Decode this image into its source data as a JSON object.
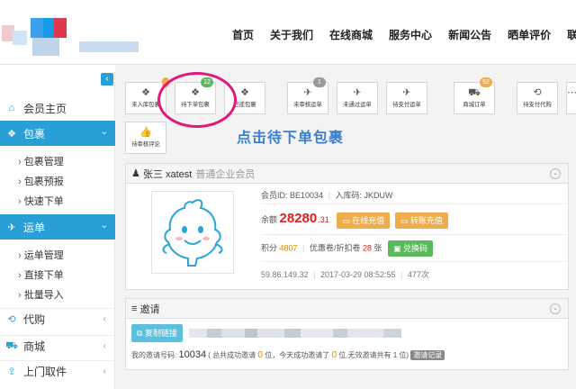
{
  "nav": {
    "items": [
      "首页",
      "关于我们",
      "在线商城",
      "服务中心",
      "新闻公告",
      "晒单评价",
      "联系"
    ]
  },
  "sidebar": {
    "home": "会员主页",
    "groups": [
      {
        "label": "包裹",
        "icon": "dropbox-icon",
        "subitems": [
          "包裹管理",
          "包裹预报",
          "快速下单"
        ]
      },
      {
        "label": "运单",
        "icon": "plane-icon",
        "subitems": [
          "运单管理",
          "直接下单",
          "批量导入"
        ]
      }
    ],
    "items": [
      {
        "label": "代购",
        "icon": "refresh-icon"
      },
      {
        "label": "商城",
        "icon": "cart-icon"
      },
      {
        "label": "上门取件",
        "icon": "upload-icon"
      }
    ]
  },
  "quick_actions": [
    {
      "label": "未入库包裹",
      "icon": "dropbox-icon",
      "badge": ""
    },
    {
      "label": "待下单包裹",
      "icon": "dropbox-icon",
      "badge": "12"
    },
    {
      "label": "已揽包裹",
      "icon": "dropbox-icon",
      "badge": ""
    },
    {
      "label": "未审核运单",
      "icon": "plane-icon",
      "badge": "1"
    },
    {
      "label": "未通过运单",
      "icon": "plane-icon",
      "badge": ""
    },
    {
      "label": "待支付运单",
      "icon": "plane-icon",
      "badge": ""
    },
    {
      "label": "商城订单",
      "icon": "cart-icon",
      "badge": "52"
    },
    {
      "label": "待支付代购",
      "icon": "refresh-icon",
      "badge": ""
    },
    {
      "label": "待审核评论",
      "icon": "thumbs-up-icon",
      "badge": ""
    }
  ],
  "annotation": "点击待下单包裹",
  "profile": {
    "name": "张三 xatest",
    "level": "普通企业会员",
    "member_id_label": "会员ID:",
    "member_id": "BE10034",
    "warehouse_label": "入库码:",
    "warehouse_code": "JKDUW",
    "balance_label": "余额",
    "balance_int": "28280",
    "balance_dec": ".31",
    "recharge_online": "在线充值",
    "recharge_transfer": "转账充值",
    "points_label": "积分",
    "points": "4807",
    "coupon_label": "优惠卷/折扣卷",
    "coupon_count": "28",
    "coupon_unit": "张",
    "exchange_label": "兑换码",
    "login_ip": "59.86.149.32",
    "login_time": "2017-03-29 08:52:55",
    "login_count": "477次"
  },
  "invite": {
    "title": "邀请",
    "copy_link": "复制链接",
    "code_label": "我的邀请号码:",
    "code": "10034",
    "success_prefix": "( 总共成功邀请",
    "success_count": "0",
    "success_unit": "位，今天成功邀请了",
    "today_count": "0",
    "today_unit": "位,无效邀请共有",
    "invalid_count": "1",
    "invalid_unit": "位)",
    "record_label": "邀请记录"
  },
  "colors": {
    "accent": "#2a9fd6",
    "highlight": "#e4177a",
    "balance": "#e02020",
    "annotation": "#3a7fd1"
  }
}
